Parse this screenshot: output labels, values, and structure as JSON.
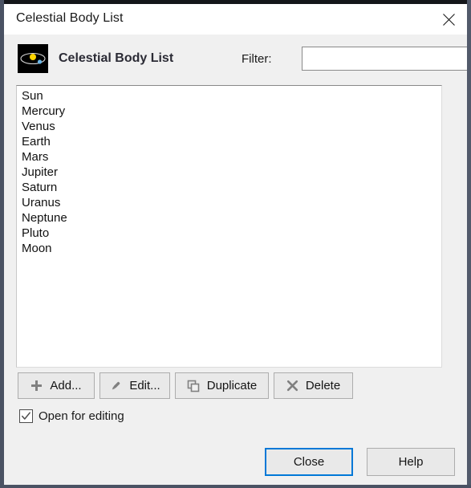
{
  "window": {
    "title": "Celestial Body List",
    "close_icon": "close-icon"
  },
  "header": {
    "icon": "solar-system-icon",
    "title": "Celestial Body List",
    "filter_label": "Filter:",
    "filter_value": "",
    "filter_placeholder": ""
  },
  "list": {
    "items": [
      "Sun",
      "Mercury",
      "Venus",
      "Earth",
      "Mars",
      "Jupiter",
      "Saturn",
      "Uranus",
      "Neptune",
      "Pluto",
      "Moon"
    ]
  },
  "actions": {
    "add": {
      "label": "Add...",
      "icon": "plus-icon"
    },
    "edit": {
      "label": "Edit...",
      "icon": "pencil-icon"
    },
    "duplicate": {
      "label": "Duplicate",
      "icon": "copy-icon"
    },
    "delete": {
      "label": "Delete",
      "icon": "cross-icon"
    }
  },
  "options": {
    "open_for_editing_label": "Open for editing",
    "open_for_editing_checked": "✓"
  },
  "footer": {
    "close_label": "Close",
    "help_label": "Help"
  },
  "colors": {
    "accent": "#0078d7",
    "dialog_bg": "#f0f0f0",
    "titlebar_bg": "#ffffff",
    "icon_sun": "#ffd400",
    "icon_planet": "#6ab7e8"
  }
}
